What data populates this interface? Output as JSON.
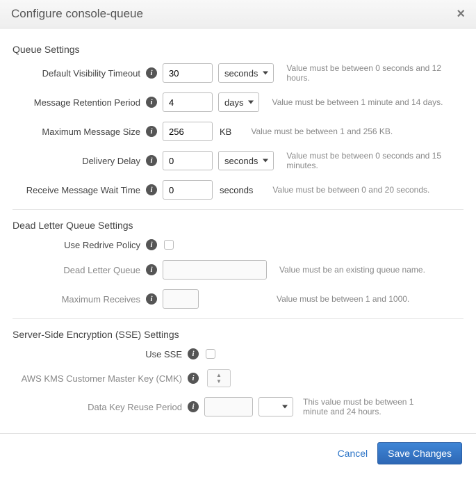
{
  "dialog": {
    "title": "Configure console-queue"
  },
  "sections": {
    "queue": "Queue Settings",
    "dlq": "Dead Letter Queue Settings",
    "sse": "Server-Side Encryption (SSE) Settings"
  },
  "queue": {
    "visibility": {
      "label": "Default Visibility Timeout",
      "value": "30",
      "unit": "seconds",
      "hint": "Value must be between 0 seconds and 12 hours."
    },
    "retention": {
      "label": "Message Retention Period",
      "value": "4",
      "unit": "days",
      "hint": "Value must be between 1 minute and 14 days."
    },
    "maxsize": {
      "label": "Maximum Message Size",
      "value": "256",
      "unit": "KB",
      "hint": "Value must be between 1 and 256 KB."
    },
    "delay": {
      "label": "Delivery Delay",
      "value": "0",
      "unit": "seconds",
      "hint": "Value must be between 0 seconds and 15 minutes."
    },
    "wait": {
      "label": "Receive Message Wait Time",
      "value": "0",
      "unit": "seconds",
      "hint": "Value must be between 0 and 20 seconds."
    }
  },
  "dlq": {
    "redrive": {
      "label": "Use Redrive Policy"
    },
    "queue": {
      "label": "Dead Letter Queue",
      "value": "",
      "hint": "Value must be an existing queue name."
    },
    "maxrecv": {
      "label": "Maximum Receives",
      "value": "",
      "hint": "Value must be between 1 and 1000."
    }
  },
  "sse": {
    "use": {
      "label": "Use SSE"
    },
    "cmk": {
      "label": "AWS KMS Customer Master Key (CMK)"
    },
    "dkr": {
      "label": "Data Key Reuse Period",
      "value": "",
      "unit": "",
      "hint": "This value must be between 1 minute and 24 hours."
    }
  },
  "footer": {
    "cancel": "Cancel",
    "save": "Save Changes"
  }
}
